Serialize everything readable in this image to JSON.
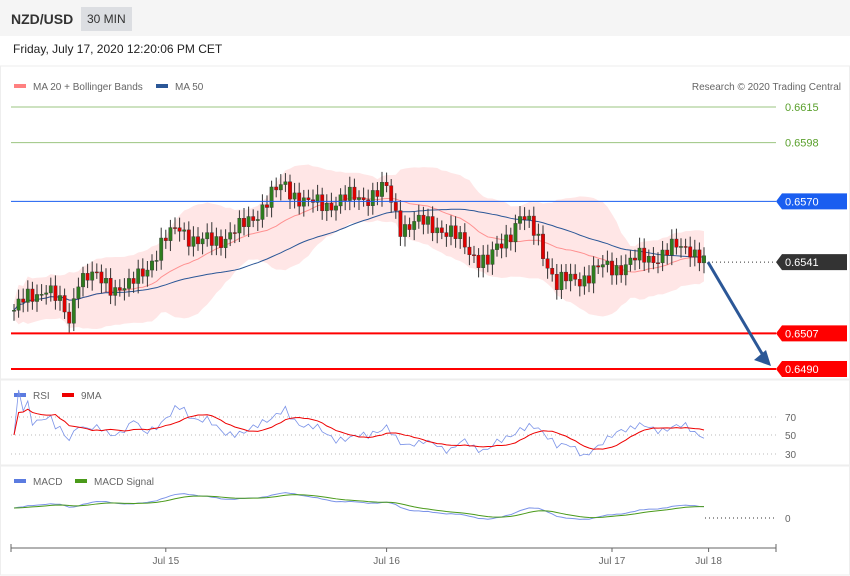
{
  "header": {
    "symbol": "NZD/USD",
    "timeframe": "30 MIN",
    "datetime": "Friday, July 17, 2020 12:20:06 PM CET"
  },
  "legend": {
    "ma20": "MA 20 + Bollinger Bands",
    "ma50": "MA 50",
    "copyright": "Research © 2020 Trading Central"
  },
  "levels": [
    {
      "label": "0.6615",
      "price": 0.6615,
      "type": "resistance-target",
      "color": "#5aa02c"
    },
    {
      "label": "0.6598",
      "price": 0.6598,
      "type": "resistance-target",
      "color": "#5aa02c"
    },
    {
      "label": "0.6570",
      "price": 0.657,
      "type": "pivot",
      "color": "#1a5ef0"
    },
    {
      "label": "0.6541",
      "price": 0.6541,
      "type": "last",
      "color": "#333333"
    },
    {
      "label": "0.6507",
      "price": 0.6507,
      "type": "support",
      "color": "#ff0000"
    },
    {
      "label": "0.6490",
      "price": 0.649,
      "type": "support",
      "color": "#ff0000"
    }
  ],
  "rsi": {
    "legend_rsi": "RSI",
    "legend_ma": "9MA",
    "ticks": [
      "70",
      "50",
      "30"
    ]
  },
  "macd": {
    "legend_macd": "MACD",
    "legend_signal": "MACD Signal",
    "ticks": [
      "0"
    ]
  },
  "xaxis": {
    "labels": [
      {
        "label": "Jul 15",
        "index": 33
      },
      {
        "label": "Jul 16",
        "index": 81
      },
      {
        "label": "Jul 17",
        "index": 130
      },
      {
        "label": "Jul 18",
        "index": 151
      }
    ]
  },
  "chart_data": {
    "type": "candlestick",
    "price_anchors": [
      [
        0,
        0.6518
      ],
      [
        7,
        0.653
      ],
      [
        12,
        0.6513
      ],
      [
        14,
        0.6535
      ],
      [
        25,
        0.6528
      ],
      [
        29,
        0.654
      ],
      [
        36,
        0.6559
      ],
      [
        40,
        0.6549
      ],
      [
        49,
        0.6556
      ],
      [
        54,
        0.6568
      ],
      [
        59,
        0.6578
      ],
      [
        64,
        0.6568
      ],
      [
        73,
        0.6571
      ],
      [
        81,
        0.6575
      ],
      [
        84,
        0.6559
      ],
      [
        92,
        0.6559
      ],
      [
        99,
        0.6547
      ],
      [
        103,
        0.654
      ],
      [
        110,
        0.6563
      ],
      [
        114,
        0.6552
      ],
      [
        118,
        0.653
      ],
      [
        127,
        0.6537
      ],
      [
        136,
        0.6542
      ],
      [
        147,
        0.6549
      ],
      [
        150,
        0.6541
      ]
    ],
    "ylim": [
      0.6485,
      0.662
    ],
    "projection": {
      "from": 0.6541,
      "to": 0.649
    }
  }
}
